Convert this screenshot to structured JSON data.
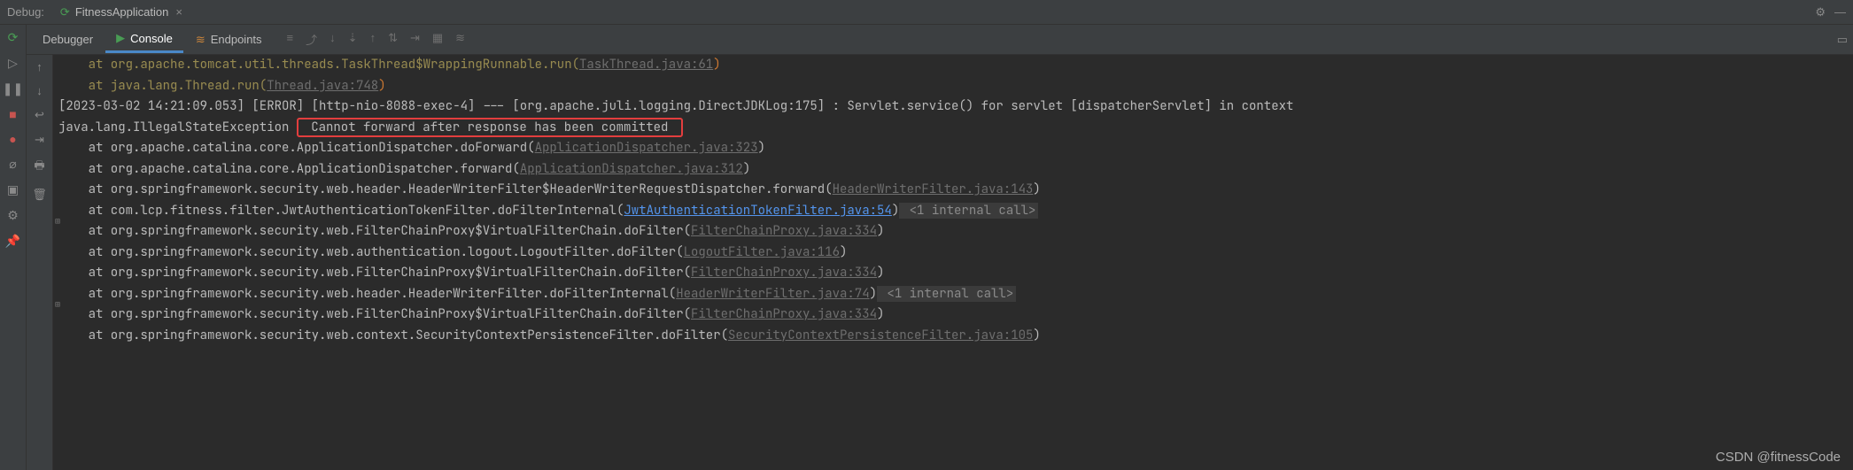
{
  "header": {
    "label": "Debug:",
    "config": "FitnessApplication"
  },
  "tabs": {
    "debugger": "Debugger",
    "console": "Console",
    "endpoints": "Endpoints"
  },
  "console": {
    "l1_pre": "    at org.apache.tomcat.util.threads.TaskThread$WrappingRunnable.run(",
    "l1_link": "TaskThread.java:61",
    "l2_pre": "    at java.lang.Thread.run(",
    "l2_link": "Thread.java:748",
    "l3": "[2023-03-02 14:21:09.053] [ERROR] [http-nio-8088-exec-4] --- [org.apache.juli.logging.DirectJDKLog:175] : Servlet.service() for servlet [dispatcherServlet] in context",
    "l4_a": "java.lang.IllegalStateException ",
    "l4_b": " Cannot forward after response has been committed ",
    "l5_pre": "    at org.apache.catalina.core.ApplicationDispatcher.doForward(",
    "l5_link": "ApplicationDispatcher.java:323",
    "l6_pre": "    at org.apache.catalina.core.ApplicationDispatcher.forward(",
    "l6_link": "ApplicationDispatcher.java:312",
    "l7_pre": "    at org.springframework.security.web.header.HeaderWriterFilter$HeaderWriterRequestDispatcher.forward(",
    "l7_link": "HeaderWriterFilter.java:143",
    "l8_pre": "    at com.lcp.fitness.filter.JwtAuthenticationTokenFilter.doFilterInternal(",
    "l8_link": "JwtAuthenticationTokenFilter.java:54",
    "l8_post": " <1 internal call>",
    "l9_pre": "    at org.springframework.security.web.FilterChainProxy$VirtualFilterChain.doFilter(",
    "l9_link": "FilterChainProxy.java:334",
    "l10_pre": "    at org.springframework.security.web.authentication.logout.LogoutFilter.doFilter(",
    "l10_link": "LogoutFilter.java:116",
    "l11_pre": "    at org.springframework.security.web.FilterChainProxy$VirtualFilterChain.doFilter(",
    "l11_link": "FilterChainProxy.java:334",
    "l12_pre": "    at org.springframework.security.web.header.HeaderWriterFilter.doFilterInternal(",
    "l12_link": "HeaderWriterFilter.java:74",
    "l12_post": " <1 internal call>",
    "l13_pre": "    at org.springframework.security.web.FilterChainProxy$VirtualFilterChain.doFilter(",
    "l13_link": "FilterChainProxy.java:334",
    "l14_pre": "    at org.springframework.security.web.context.SecurityContextPersistenceFilter.doFilter(",
    "l14_link": "SecurityContextPersistenceFilter.java:105",
    "paren": ")"
  },
  "watermark": "CSDN @fitnessCode"
}
